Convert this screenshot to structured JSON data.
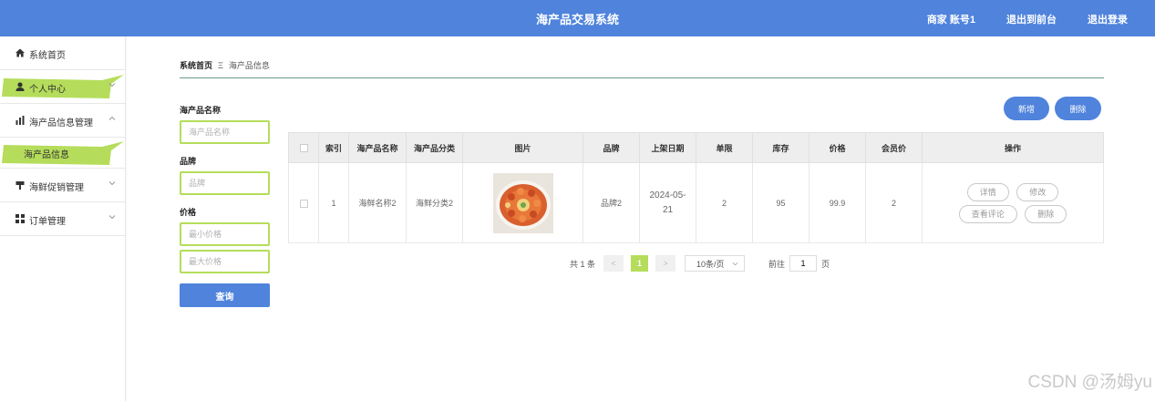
{
  "header": {
    "title": "海产品交易系统",
    "account": "商家 账号1",
    "back_to_admin": "退出到前台",
    "logout": "退出登录"
  },
  "sidebar": {
    "items": [
      {
        "label": "系统首页",
        "icon": "home-icon"
      },
      {
        "label": "个人中心",
        "icon": "user-icon"
      },
      {
        "label": "海产品信息管理",
        "icon": "bar-chart-icon"
      },
      {
        "label": "海产品信息",
        "icon": ""
      },
      {
        "label": "海鲜促销管理",
        "icon": "promo-icon"
      },
      {
        "label": "订单管理",
        "icon": "grid-icon"
      }
    ]
  },
  "breadcrumb": {
    "home": "系统首页",
    "separator": "Ξ",
    "current": "海产品信息"
  },
  "search": {
    "name_label": "海产品名称",
    "name_placeholder": "海产品名称",
    "brand_label": "品牌",
    "brand_placeholder": "品牌",
    "price_label": "价格",
    "min_price_placeholder": "最小价格",
    "max_price_placeholder": "最大价格",
    "query_button": "查询"
  },
  "actions": {
    "add": "新增",
    "delete": "删除"
  },
  "table": {
    "headers": [
      "索引",
      "海产品名称",
      "海产品分类",
      "图片",
      "品牌",
      "上架日期",
      "单限",
      "库存",
      "价格",
      "会员价",
      "操作"
    ],
    "rows": [
      {
        "index": "1",
        "name": "海鲜名称2",
        "category": "海鲜分类2",
        "brand": "品牌2",
        "date": "2024-05-21",
        "limit": "2",
        "stock": "95",
        "price": "99.9",
        "member_price": "2",
        "ops": {
          "detail": "详情",
          "edit": "修改",
          "comments": "查看评论",
          "delete": "删除"
        }
      }
    ]
  },
  "pagination": {
    "total": "共 1 条",
    "prev": "<",
    "current": "1",
    "next": ">",
    "page_size": "10条/页",
    "goto_prefix": "前往",
    "goto_value": "1",
    "goto_suffix": "页"
  },
  "watermark": "CSDN @汤姆yu",
  "colors": {
    "primary": "#4f83dc",
    "accent": "#b5dd5b"
  }
}
